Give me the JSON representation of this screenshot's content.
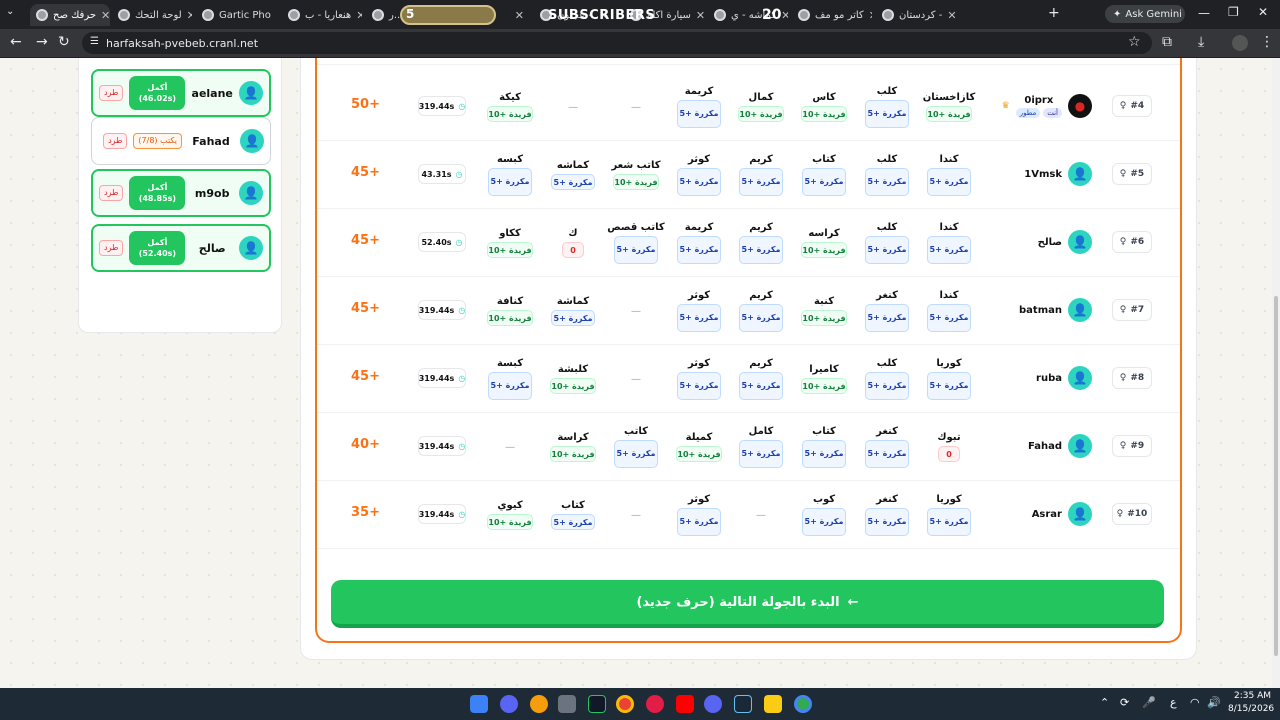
{
  "browser": {
    "tabs": [
      {
        "label": "حرفك صح",
        "active": true
      },
      {
        "label": "لوحة التحك"
      },
      {
        "label": "Gartic Pho"
      },
      {
        "label": "هنعاريا - ب"
      },
      {
        "label": "ر..."
      },
      {
        "label": "طاح"
      },
      {
        "label": "عجلون -"
      },
      {
        "label": "سيارة اكلة"
      },
      {
        "label": "كماشه - ي"
      },
      {
        "label": "كاتر مو مف"
      },
      {
        "label": "كردستان -"
      }
    ],
    "overlay": {
      "subscribers_label": "SUBSCRIBERS",
      "left_count": "5",
      "right_count": "20"
    },
    "ask_gemini": "Ask Gemini",
    "url": "harfaksah-pvebeb.cranl.net"
  },
  "sidebar": {
    "players": [
      {
        "name": "aelane",
        "status": "أكمل",
        "time": "(46.02s)",
        "kick": "طرد"
      },
      {
        "name": "Fahad",
        "status": "يكتب (7/8)",
        "kick": "طرد"
      },
      {
        "name": "m9ob",
        "status": "أكمل",
        "time": "(48.85s)",
        "kick": "طرد"
      },
      {
        "name": "صالح",
        "status": "أكمل",
        "time": "(52.40s)",
        "kick": "طرد"
      }
    ]
  },
  "rows": [
    {
      "rank": "#4",
      "name": "0iprx",
      "badges": [
        "مطور",
        "أنت"
      ],
      "time": "319.44s",
      "score": "50+",
      "cells": [
        {
          "w": "كازاخستان",
          "b": "فريدة +10",
          "t": "g"
        },
        {
          "w": "كلب",
          "b": "مكررة +5",
          "t": "b"
        },
        {
          "w": "كاس",
          "b": "فريدة +10",
          "t": "g"
        },
        {
          "w": "كمال",
          "b": "فريدة +10",
          "t": "g"
        },
        {
          "w": "كريمة",
          "b": "مكررة +5",
          "t": "b"
        },
        {
          "w": "",
          "b": "—",
          "t": "d"
        },
        {
          "w": "",
          "b": "—",
          "t": "d"
        },
        {
          "w": "كيكة",
          "b": "فريدة +10",
          "t": "g"
        }
      ]
    },
    {
      "rank": "#5",
      "name": "1Vmsk",
      "time": "43.31s",
      "score": "45+",
      "cells": [
        {
          "w": "كندا",
          "b": "مكررة +5",
          "t": "b"
        },
        {
          "w": "كلب",
          "b": "مكررة +5",
          "t": "b"
        },
        {
          "w": "كتاب",
          "b": "مكررة +5",
          "t": "b"
        },
        {
          "w": "كريم",
          "b": "مكررة +5",
          "t": "b"
        },
        {
          "w": "كوثر",
          "b": "مكررة +5",
          "t": "b"
        },
        {
          "w": "كاتب شعر",
          "b": "فريدة +10",
          "t": "g"
        },
        {
          "w": "كماشه",
          "b": "مكررة +5",
          "t": "b1"
        },
        {
          "w": "كبسه",
          "b": "مكررة +5",
          "t": "b"
        }
      ]
    },
    {
      "rank": "#6",
      "name": "صالح",
      "time": "52.40s",
      "score": "45+",
      "cells": [
        {
          "w": "كندا",
          "b": "مكررة +5",
          "t": "b"
        },
        {
          "w": "كلب",
          "b": "مكررة +5",
          "t": "b"
        },
        {
          "w": "كراسه",
          "b": "فريدة +10",
          "t": "g"
        },
        {
          "w": "كريم",
          "b": "مكررة +5",
          "t": "b"
        },
        {
          "w": "كريمة",
          "b": "مكررة +5",
          "t": "b"
        },
        {
          "w": "كاتب قصص",
          "b": "مكررة +5",
          "t": "b"
        },
        {
          "w": "ك",
          "b": "0",
          "t": "r"
        },
        {
          "w": "ككاو",
          "b": "فريدة +10",
          "t": "g"
        }
      ]
    },
    {
      "rank": "#7",
      "name": "batman",
      "time": "319.44s",
      "score": "45+",
      "cells": [
        {
          "w": "كندا",
          "b": "مكررة +5",
          "t": "b"
        },
        {
          "w": "كنغر",
          "b": "مكررة +5",
          "t": "b"
        },
        {
          "w": "كنبة",
          "b": "فريدة +10",
          "t": "g"
        },
        {
          "w": "كريم",
          "b": "مكررة +5",
          "t": "b"
        },
        {
          "w": "كوثر",
          "b": "مكررة +5",
          "t": "b"
        },
        {
          "w": "",
          "b": "—",
          "t": "d"
        },
        {
          "w": "كماشة",
          "b": "مكررة +5",
          "t": "b1"
        },
        {
          "w": "كنافة",
          "b": "فريدة +10",
          "t": "g"
        }
      ]
    },
    {
      "rank": "#8",
      "name": "ruba",
      "time": "319.44s",
      "score": "45+",
      "cells": [
        {
          "w": "كوريا",
          "b": "مكررة +5",
          "t": "b"
        },
        {
          "w": "كلب",
          "b": "مكررة +5",
          "t": "b"
        },
        {
          "w": "كاميرا",
          "b": "فريدة +10",
          "t": "g"
        },
        {
          "w": "كريم",
          "b": "مكررة +5",
          "t": "b"
        },
        {
          "w": "كوثر",
          "b": "مكررة +5",
          "t": "b"
        },
        {
          "w": "",
          "b": "—",
          "t": "d"
        },
        {
          "w": "كلبشة",
          "b": "فريدة +10",
          "t": "g"
        },
        {
          "w": "كبسة",
          "b": "مكررة +5",
          "t": "b"
        }
      ]
    },
    {
      "rank": "#9",
      "name": "Fahad",
      "time": "319.44s",
      "score": "40+",
      "cells": [
        {
          "w": "تبوك",
          "b": "0",
          "t": "r"
        },
        {
          "w": "كنغر",
          "b": "مكررة +5",
          "t": "b"
        },
        {
          "w": "كتاب",
          "b": "مكررة +5",
          "t": "b"
        },
        {
          "w": "كامل",
          "b": "مكررة +5",
          "t": "b"
        },
        {
          "w": "كميلة",
          "b": "فريدة +10",
          "t": "g"
        },
        {
          "w": "كاتب",
          "b": "مكررة +5",
          "t": "b"
        },
        {
          "w": "كراسة",
          "b": "فريدة +10",
          "t": "g"
        },
        {
          "w": "",
          "b": "—",
          "t": "d"
        }
      ]
    },
    {
      "rank": "#10",
      "name": "Asrar",
      "time": "319.44s",
      "score": "35+",
      "cells": [
        {
          "w": "كوريا",
          "b": "مكررة +5",
          "t": "b"
        },
        {
          "w": "كنغر",
          "b": "مكررة +5",
          "t": "b"
        },
        {
          "w": "كوب",
          "b": "مكررة +5",
          "t": "b"
        },
        {
          "w": "",
          "b": "—",
          "t": "d"
        },
        {
          "w": "كوثر",
          "b": "مكررة +5",
          "t": "b"
        },
        {
          "w": "",
          "b": "—",
          "t": "d"
        },
        {
          "w": "كتاب",
          "b": "مكررة +5",
          "t": "b1"
        },
        {
          "w": "كيوي",
          "b": "فريدة +10",
          "t": "g"
        }
      ]
    }
  ],
  "next_round_label": "البدء بالجولة التالية (حرف جديد)",
  "taskbar": {
    "lang": "ع",
    "time": "2:35 AM",
    "date": "8/15/2026"
  }
}
